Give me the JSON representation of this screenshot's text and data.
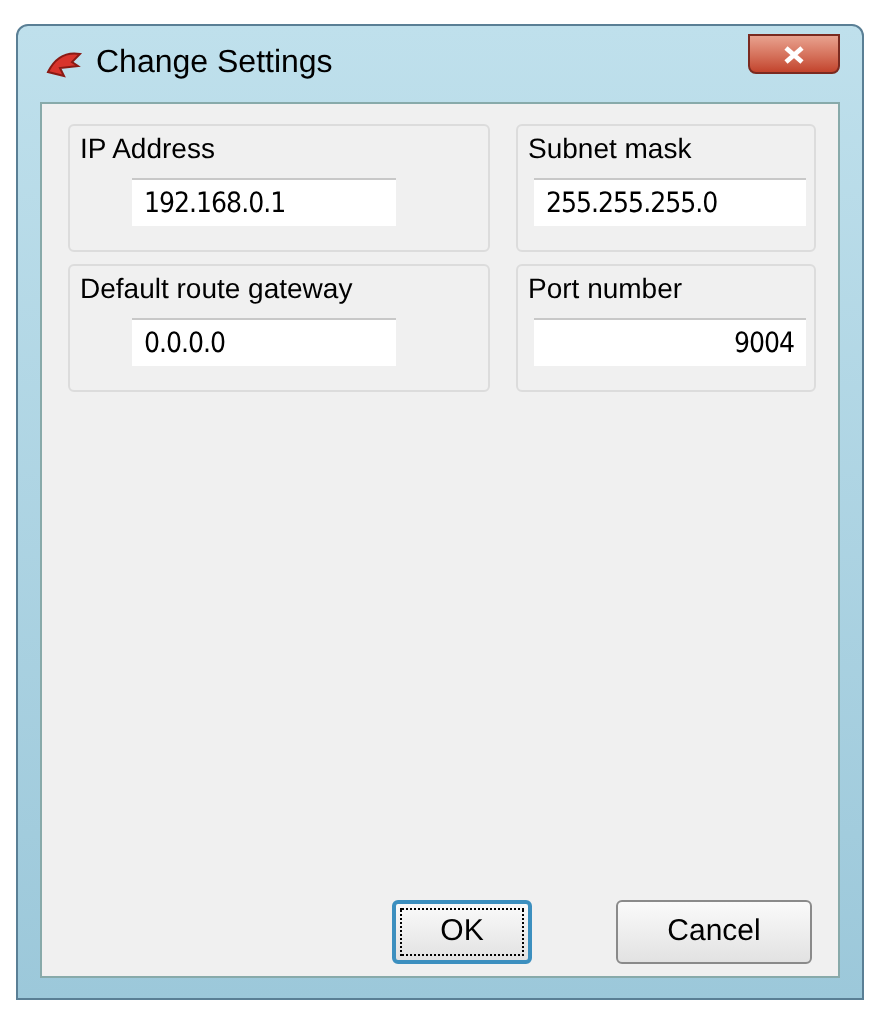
{
  "window": {
    "title": "Change Settings"
  },
  "fields": [
    {
      "label": "IP Address",
      "value": "192.168.0.1",
      "kind": "text"
    },
    {
      "label": "Subnet mask",
      "value": "255.255.255.0",
      "kind": "text"
    },
    {
      "label": "Default route gateway",
      "value": "0.0.0.0",
      "kind": "text"
    },
    {
      "label": "Port number",
      "value": "9004",
      "kind": "number"
    }
  ],
  "buttons": [
    {
      "label": "OK",
      "focused": true
    },
    {
      "label": "Cancel",
      "focused": false
    }
  ]
}
